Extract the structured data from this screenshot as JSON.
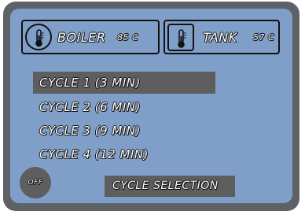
{
  "boiler": {
    "label": "BOILER",
    "temp": "85 C",
    "icon": "thermometer-icon"
  },
  "tank": {
    "label": "TANK",
    "temp": "57 C",
    "icon": "thermometer-icon"
  },
  "cycles": [
    {
      "label": "CYCLE 1 (3 MIN)",
      "selected": true
    },
    {
      "label": "CYCLE 2 (6 MIN)",
      "selected": false
    },
    {
      "label": "CYCLE 3 (9 MIN)",
      "selected": false
    },
    {
      "label": "CYCLE 4 (12 MIN)",
      "selected": false
    }
  ],
  "off_button": {
    "label": "OFF"
  },
  "footer": {
    "title": "CYCLE SELECTION"
  },
  "colors": {
    "screen": "#7f9fc8",
    "bezel": "#5e6266",
    "highlight": "#5e5e5e",
    "text": "#ffffff"
  }
}
